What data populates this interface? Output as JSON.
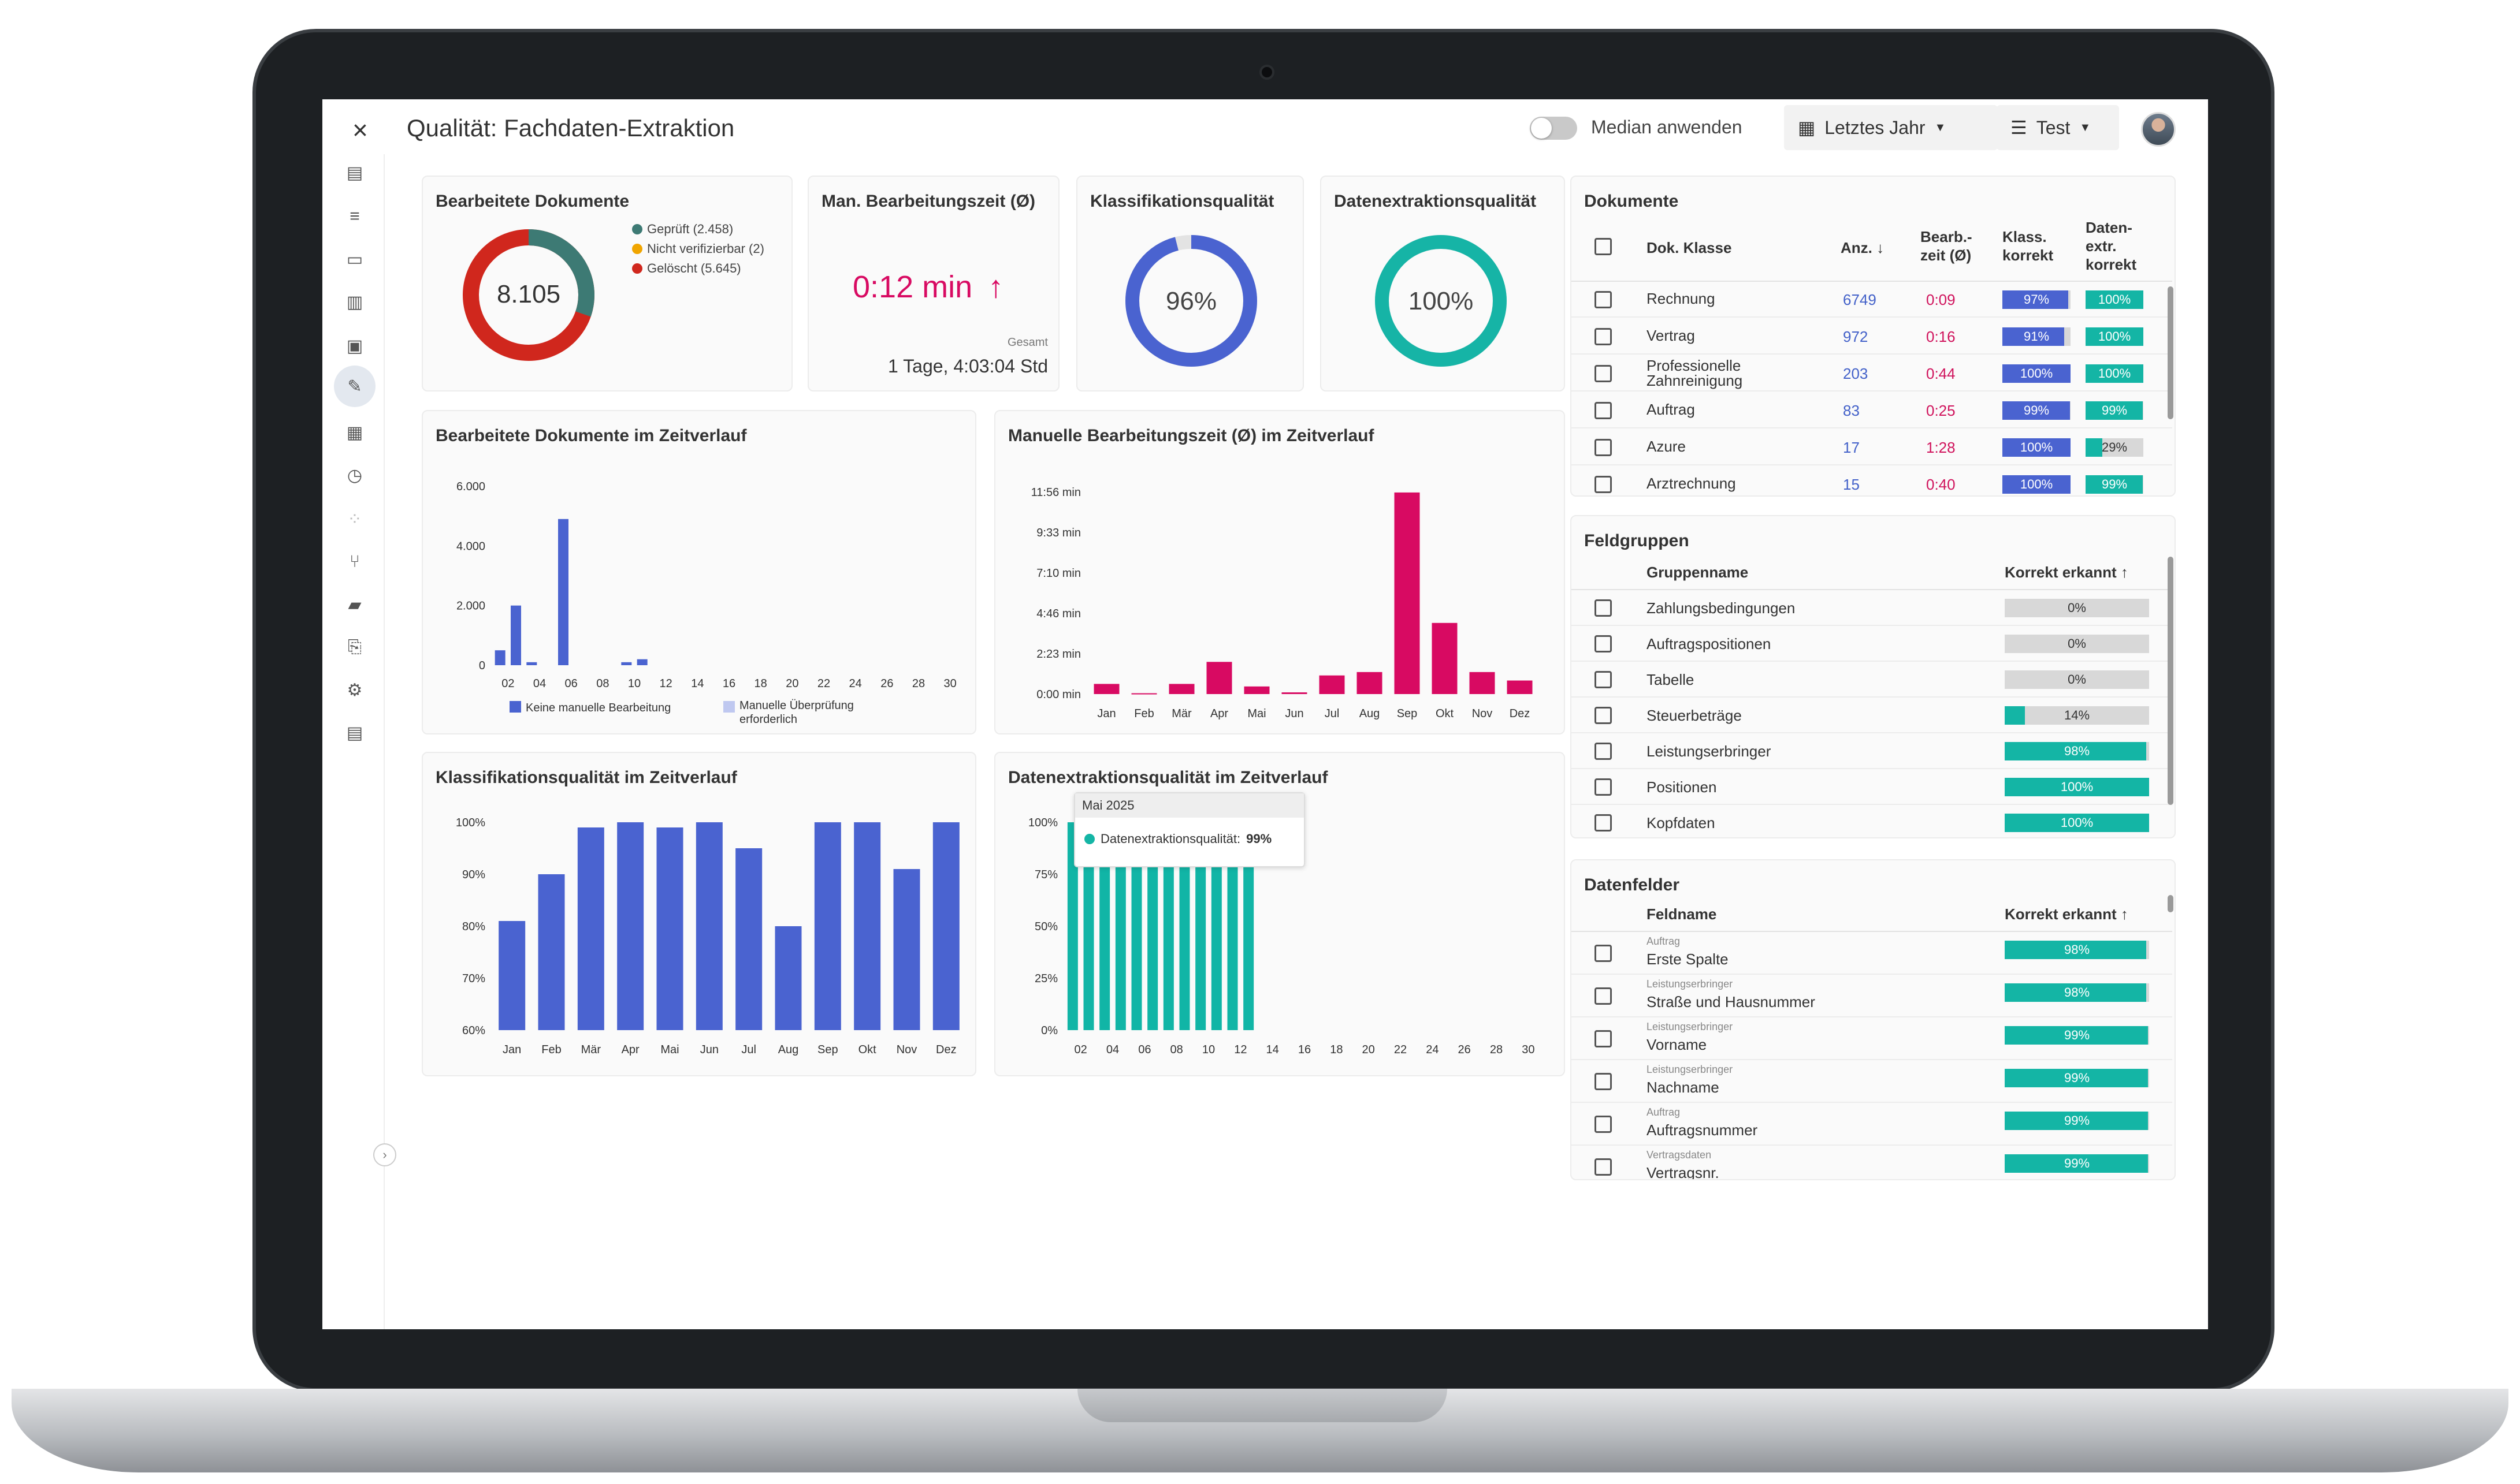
{
  "header": {
    "title": "Qualität: Fachdaten-Extraktion",
    "close_icon": "×",
    "median_label": "Median anwenden",
    "period_label": "Letztes Jahr",
    "view_label": "Test"
  },
  "kpis": {
    "docs": {
      "title": "Bearbeitete Dokumente",
      "total": "8.105",
      "legend": [
        {
          "label": "Geprüft (2.458)",
          "value": 2458,
          "color": "#3d7a74"
        },
        {
          "label": "Nicht verifizierbar (2)",
          "value": 2,
          "color": "#f0a500"
        },
        {
          "label": "Gelöscht (5.645)",
          "value": 5645,
          "color": "#d0271d"
        }
      ]
    },
    "time": {
      "title": "Man. Bearbeitungszeit (Ø)",
      "value": "0:12 min",
      "total_label": "Gesamt",
      "total": "1 Tage, 4:03:04 Std"
    },
    "class": {
      "title": "Klassifikationsqualität",
      "value": "96%",
      "pct": 96,
      "color": "#4a63d0"
    },
    "extract": {
      "title": "Datenextraktionsqualität",
      "value": "100%",
      "pct": 100,
      "color": "#16b4a6"
    }
  },
  "charts": {
    "docs_time": {
      "title": "Bearbeitete Dokumente im Zeitverlauf",
      "yticks": [
        "6.000",
        "4.000",
        "2.000",
        "0"
      ],
      "xticks": [
        "02",
        "04",
        "06",
        "08",
        "10",
        "12",
        "14",
        "16",
        "18",
        "20",
        "22",
        "24",
        "26",
        "28",
        "30"
      ],
      "legend": [
        "Keine manuelle Bearbeitung",
        "Manuelle Überprüfung",
        "erforderlich"
      ]
    },
    "time_series": {
      "title": "Manuelle Bearbeitungszeit (Ø) im Zeitverlauf",
      "yticks": [
        "11:56 min",
        "9:33 min",
        "7:10 min",
        "4:46 min",
        "2:23 min",
        "0:00 min"
      ],
      "months": [
        "Jan",
        "Feb",
        "Mär",
        "Apr",
        "Mai",
        "Jun",
        "Jul",
        "Aug",
        "Sep",
        "Okt",
        "Nov",
        "Dez"
      ]
    },
    "class_time": {
      "title": "Klassifikationsqualität im Zeitverlauf",
      "yticks": [
        "100%",
        "90%",
        "80%",
        "70%",
        "60%"
      ],
      "months": [
        "Jan",
        "Feb",
        "Mär",
        "Apr",
        "Mai",
        "Jun",
        "Jul",
        "Aug",
        "Sep",
        "Okt",
        "Nov",
        "Dez"
      ]
    },
    "extract_time": {
      "title": "Datenextraktionsqualität im Zeitverlauf",
      "yticks": [
        "100%",
        "75%",
        "50%",
        "25%",
        "0%"
      ],
      "xticks": [
        "02",
        "04",
        "06",
        "08",
        "10",
        "12",
        "14",
        "16",
        "18",
        "20",
        "22",
        "24",
        "26",
        "28",
        "30"
      ],
      "tooltip_title": "Mai 2025",
      "tooltip_label": "Datenextraktionsqualität:",
      "tooltip_value": "99%"
    }
  },
  "chart_data": [
    {
      "type": "bar",
      "title": "Bearbeitete Dokumente im Zeitverlauf",
      "x": [
        1,
        2,
        3,
        4,
        5,
        6,
        7,
        8,
        9,
        10,
        11,
        12
      ],
      "series": [
        {
          "name": "Keine manuelle Bearbeitung",
          "values": [
            500,
            2000,
            100,
            0,
            4900,
            0,
            0,
            0,
            100,
            200,
            0,
            0
          ]
        },
        {
          "name": "Manuelle Überprüfung erforderlich",
          "values": [
            0,
            0,
            0,
            0,
            0,
            0,
            0,
            0,
            0,
            0,
            0,
            0
          ]
        }
      ],
      "ylim": [
        0,
        6000
      ]
    },
    {
      "type": "bar",
      "title": "Manuelle Bearbeitungszeit (Ø) im Zeitverlauf",
      "categories": [
        "Jan",
        "Feb",
        "Mär",
        "Apr",
        "Mai",
        "Jun",
        "Jul",
        "Aug",
        "Sep",
        "Okt",
        "Nov",
        "Dez"
      ],
      "values": [
        0.6,
        0.05,
        0.6,
        1.9,
        0.45,
        0.1,
        1.1,
        1.3,
        11.9,
        4.2,
        1.3,
        0.8
      ],
      "ylim": [
        0,
        11.93
      ]
    },
    {
      "type": "bar",
      "title": "Klassifikationsqualität im Zeitverlauf",
      "categories": [
        "Jan",
        "Feb",
        "Mär",
        "Apr",
        "Mai",
        "Jun",
        "Jul",
        "Aug",
        "Sep",
        "Okt",
        "Nov",
        "Dez"
      ],
      "values": [
        81,
        90,
        99,
        100,
        99,
        100,
        95,
        80,
        100,
        100,
        91,
        100
      ],
      "ylim": [
        60,
        100
      ]
    },
    {
      "type": "bar",
      "title": "Datenextraktionsqualität im Zeitverlauf",
      "x": [
        1,
        2,
        3,
        4,
        5,
        6,
        7,
        8,
        9,
        10,
        11,
        12
      ],
      "values": [
        100,
        100,
        100,
        100,
        99,
        100,
        100,
        100,
        100,
        100,
        100,
        100
      ],
      "ylim": [
        0,
        100
      ]
    }
  ],
  "documents": {
    "title": "Dokumente",
    "col_class": "Dok. Klasse",
    "col_count": "Anz.",
    "col_time": [
      "Bearb.-",
      "zeit (Ø)"
    ],
    "col_klass": [
      "Klass.",
      "korrekt"
    ],
    "col_extr": [
      "Daten-",
      "extr.",
      "korrekt"
    ],
    "rows": [
      {
        "name": "Rechnung",
        "count": "6749",
        "time": "0:09",
        "klass": "97%",
        "klass_v": 97,
        "extr": "100%",
        "extr_v": 100
      },
      {
        "name": "Vertrag",
        "count": "972",
        "time": "0:16",
        "klass": "91%",
        "klass_v": 91,
        "extr": "100%",
        "extr_v": 100
      },
      {
        "name": "Professionelle Zahnreinigung",
        "count": "203",
        "time": "0:44",
        "klass": "100%",
        "klass_v": 100,
        "extr": "100%",
        "extr_v": 100
      },
      {
        "name": "Auftrag",
        "count": "83",
        "time": "0:25",
        "klass": "99%",
        "klass_v": 99,
        "extr": "99%",
        "extr_v": 99
      },
      {
        "name": "Azure",
        "count": "17",
        "time": "1:28",
        "klass": "100%",
        "klass_v": 100,
        "extr": "29%",
        "extr_v": 29
      },
      {
        "name": "Arztrechnung",
        "count": "15",
        "time": "0:40",
        "klass": "100%",
        "klass_v": 100,
        "extr": "99%",
        "extr_v": 99
      }
    ]
  },
  "fieldgroups": {
    "title": "Feldgruppen",
    "col_name": "Gruppenname",
    "col_correct": "Korrekt erkannt",
    "rows": [
      {
        "name": "Zahlungsbedingungen",
        "pct": "0%",
        "v": 0
      },
      {
        "name": "Auftragspositionen",
        "pct": "0%",
        "v": 0
      },
      {
        "name": "Tabelle",
        "pct": "0%",
        "v": 0
      },
      {
        "name": "Steuerbeträge",
        "pct": "14%",
        "v": 14
      },
      {
        "name": "Leistungserbringer",
        "pct": "98%",
        "v": 98
      },
      {
        "name": "Positionen",
        "pct": "100%",
        "v": 100
      },
      {
        "name": "Kopfdaten",
        "pct": "100%",
        "v": 100
      }
    ]
  },
  "datafields": {
    "title": "Datenfelder",
    "col_name": "Feldname",
    "col_correct": "Korrekt erkannt",
    "rows": [
      {
        "group": "Auftrag",
        "name": "Erste Spalte",
        "pct": "98%",
        "v": 98
      },
      {
        "group": "Leistungserbringer",
        "name": "Straße und Hausnummer",
        "pct": "98%",
        "v": 98
      },
      {
        "group": "Leistungserbringer",
        "name": "Vorname",
        "pct": "99%",
        "v": 99
      },
      {
        "group": "Leistungserbringer",
        "name": "Nachname",
        "pct": "99%",
        "v": 99
      },
      {
        "group": "Auftrag",
        "name": "Auftragsnummer",
        "pct": "99%",
        "v": 99
      },
      {
        "group": "Vertragsdaten",
        "name": "Vertragsnr.",
        "pct": "99%",
        "v": 99
      }
    ]
  },
  "colors": {
    "blue": "#4a63d0",
    "pink": "#d80a62",
    "teal": "#14b5a5",
    "teal_bar": "#11b5a6"
  }
}
